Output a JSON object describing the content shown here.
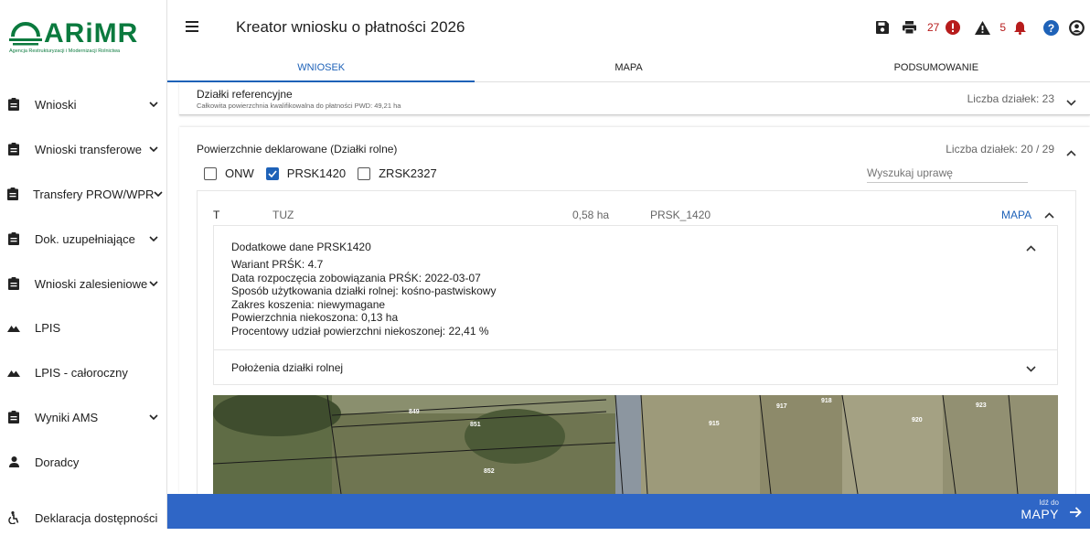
{
  "logo": {
    "name": "ARiMR",
    "subtitle": "Agencja Restrukturyzacji i Modernizacji Rolnictwa"
  },
  "sidebar": {
    "items": [
      {
        "label": "Wnioski",
        "icon": "clipboard-icon",
        "has_chevron": true
      },
      {
        "label": "Wnioski transferowe",
        "icon": "clipboard-icon",
        "has_chevron": true
      },
      {
        "label": "Transfery PROW/WPR",
        "icon": "clipboard-icon",
        "has_chevron": true
      },
      {
        "label": "Dok. uzupełniające",
        "icon": "clipboard-icon",
        "has_chevron": true
      },
      {
        "label": "Wnioski zalesieniowe",
        "icon": "clipboard-icon",
        "has_chevron": true
      },
      {
        "label": "LPIS",
        "icon": "terrain-icon",
        "has_chevron": false
      },
      {
        "label": "LPIS - całoroczny",
        "icon": "terrain-icon",
        "has_chevron": false
      },
      {
        "label": "Wyniki AMS",
        "icon": "clipboard-icon",
        "has_chevron": true
      },
      {
        "label": "Doradcy",
        "icon": "person-icon",
        "has_chevron": false
      },
      {
        "label": "Deklaracja dostępności",
        "icon": "accessibility-icon",
        "has_chevron": false
      }
    ]
  },
  "header": {
    "title": "Kreator wniosku o płatności 2026",
    "error_count": "27",
    "warning_count": "5",
    "tabs": [
      {
        "label": "WNIOSEK",
        "active": true
      },
      {
        "label": "MAPA",
        "active": false
      },
      {
        "label": "PODSUMOWANIE",
        "active": false
      }
    ]
  },
  "reference_plots": {
    "title": "Działki referencyjne",
    "subtitle": "Całkowita powierzchnia kwalifikowalna do płatności PWD: 49,21 ha",
    "count": "Liczba działek: 23"
  },
  "declared": {
    "title": "Powierzchnie deklarowane (Działki rolne)",
    "count": "Liczba działek: 20 / 29",
    "filters": [
      {
        "label": "ONW",
        "checked": false
      },
      {
        "label": "PRSK1420",
        "checked": true
      },
      {
        "label": "ZRSK2327",
        "checked": false
      }
    ],
    "search_placeholder": "Wyszukaj uprawę"
  },
  "plot_row": {
    "symbol": "T",
    "crop": "TUZ",
    "area": "0,58 ha",
    "program": "PRSK_1420",
    "map_link": "MAPA"
  },
  "extra_data": {
    "title": "Dodatkowe dane PRSK1420",
    "lines": [
      "Wariant PRŚK: 4.7",
      "Data rozpoczęcia zobowiązania PRŚK: 2022-03-07",
      "Sposób użytkowania działki rolnej: kośno-pastwiskowy",
      "Zakres koszenia: niewymagane",
      "Powierzchnia niekoszona: 0,13 ha",
      "Procentowy udział powierzchni niekoszonej: 22,41 %"
    ]
  },
  "location": {
    "title": "Położenia działki rolnej"
  },
  "map_labels": [
    "849",
    "851",
    "852",
    "915",
    "917",
    "918",
    "920",
    "923"
  ],
  "footer": {
    "small": "Idź do",
    "big": "MAPY"
  },
  "colors": {
    "accent": "#2f66c6",
    "brand": "#0b7a3e",
    "error": "#b71c1c"
  }
}
